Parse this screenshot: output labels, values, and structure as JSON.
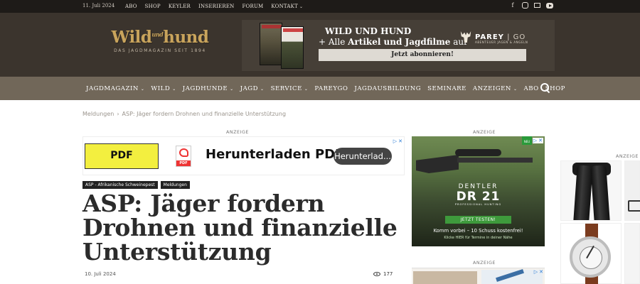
{
  "topbar": {
    "date": "11. Juli 2024",
    "links": [
      "ABO",
      "SHOP",
      "KEYLER",
      "INSERIEREN",
      "FORUM",
      "KONTAKT"
    ],
    "kontakt_caret": "⌄",
    "social_fb": "f",
    "social_icons": [
      "facebook-icon",
      "instagram-icon",
      "mail-icon",
      "youtube-icon"
    ]
  },
  "header": {
    "logo_word_1": "Wild",
    "logo_und": "und",
    "logo_word_2": "hund",
    "logo_tagline": "DAS JAGDMAGAZIN SEIT 1894",
    "promo": {
      "line1": "WILD UND HUND",
      "line2_prefix": "+ Alle ",
      "line2_bold": "Artikel und Jagdfilme",
      "line2_suffix": " auf",
      "brand": "PAREY",
      "brand_sep": " | GO",
      "brand_sub": "ABENTEUER JAGEN & ANGELN",
      "cta": "Jetzt abonnieren!"
    }
  },
  "nav": {
    "items": [
      {
        "label": "JAGDMAGAZIN",
        "caret": true
      },
      {
        "label": "WILD",
        "caret": true
      },
      {
        "label": "JAGDHUNDE",
        "caret": true
      },
      {
        "label": "JAGD",
        "caret": true
      },
      {
        "label": "SERVICE",
        "caret": true
      },
      {
        "label": "PAREYGO",
        "caret": false
      },
      {
        "label": "JAGDAUSBILDUNG",
        "caret": false
      },
      {
        "label": "SEMINARE",
        "caret": false
      },
      {
        "label": "ANZEIGEN",
        "caret": true
      },
      {
        "label": "ABO",
        "caret": false
      },
      {
        "label": "SHOP",
        "caret": false
      }
    ],
    "caret_glyph": "⌄"
  },
  "breadcrumb": {
    "parent": "Meldungen",
    "separator": "›",
    "current": "ASP: Jäger fordern Drohnen und finanzielle Unterstützung"
  },
  "ads": {
    "label": "ANZEIGE",
    "left": {
      "button": "PDF",
      "icon_label": "PDF",
      "headline": "Herunterladen PDF",
      "cta": "Herunterlad..."
    },
    "right": {
      "new_badge": "NEU",
      "brand": "DENTLER",
      "model": "DR 21",
      "sub": "PROFESSIONAL HUNTING",
      "cta": "JETZT TESTEN!",
      "line1": "Komm vorbei – 10 Schuss kostenfrei!",
      "line2": "Klicke HIER für Termine in deiner Nähe"
    },
    "adchoices": "▷",
    "close": "✕"
  },
  "article": {
    "tags": [
      "ASP - Afrikanische Schweinepest",
      "Meldungen"
    ],
    "title": "ASP: Jäger fordern Drohnen und finanzielle Unterstützung",
    "date": "10. Juli 2024",
    "views": "177"
  }
}
